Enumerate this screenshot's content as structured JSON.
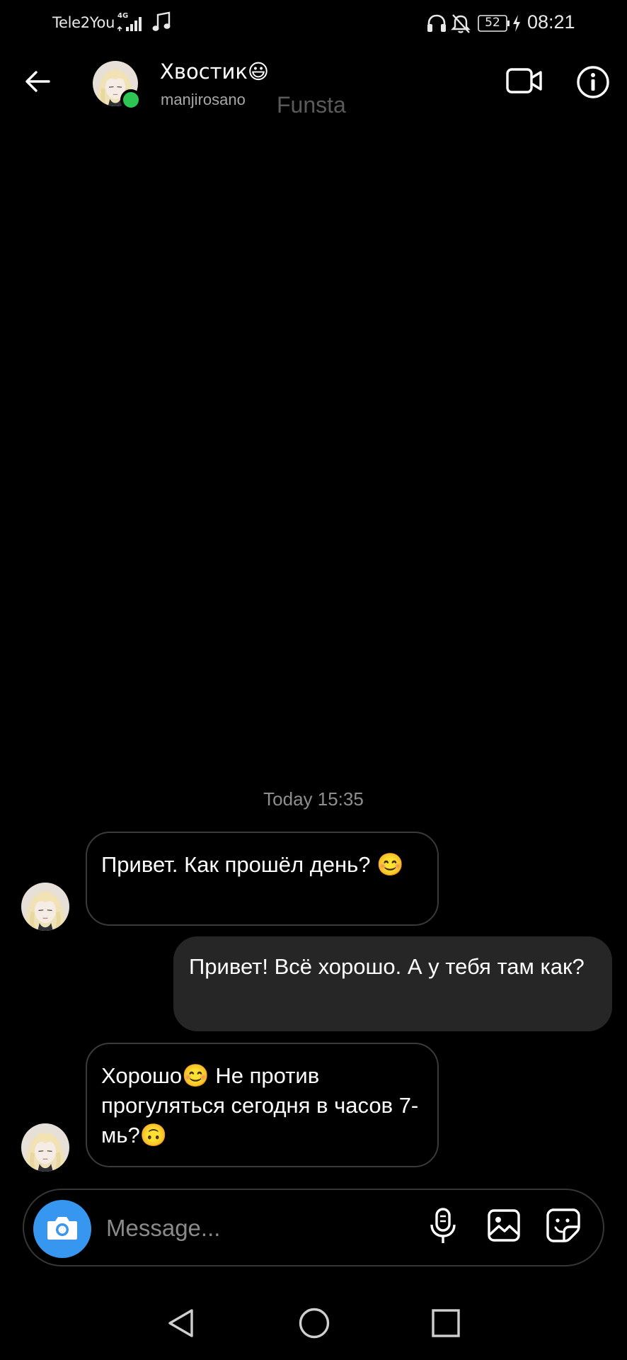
{
  "status_bar": {
    "carrier": "Tele2You",
    "network": "4G",
    "battery": "52",
    "time": "08:21",
    "icons": [
      "signal-icon",
      "music-note-icon",
      "headphones-icon",
      "bell-off-icon",
      "battery-icon",
      "charging-icon"
    ]
  },
  "header": {
    "back_icon": "arrow-left-icon",
    "contact_name": "Хвостик😃",
    "username": "manjirosano",
    "watermark": "Funsta",
    "online": true,
    "actions": [
      "video-call-icon",
      "info-icon"
    ]
  },
  "conversation": {
    "timestamp": "Today 15:35",
    "messages": [
      {
        "direction": "incoming",
        "text": "Привет. Как прошёл день? 😊"
      },
      {
        "direction": "outgoing",
        "text": "Привет! Всё хорошо. А у тебя там как?"
      },
      {
        "direction": "incoming",
        "text": "Хорошо😊 Не против прогуляться сегодня в часов 7-мь?🙃"
      }
    ]
  },
  "composer": {
    "placeholder": "Message...",
    "icons": [
      "camera-icon",
      "microphone-icon",
      "gallery-icon",
      "sticker-icon"
    ]
  },
  "colors": {
    "background": "#000000",
    "accent": "#3797f0",
    "online": "#2dc653",
    "outgoing_bubble": "#262626"
  },
  "nav_bar": {
    "icons": [
      "nav-back-icon",
      "nav-home-icon",
      "nav-recents-icon"
    ]
  }
}
